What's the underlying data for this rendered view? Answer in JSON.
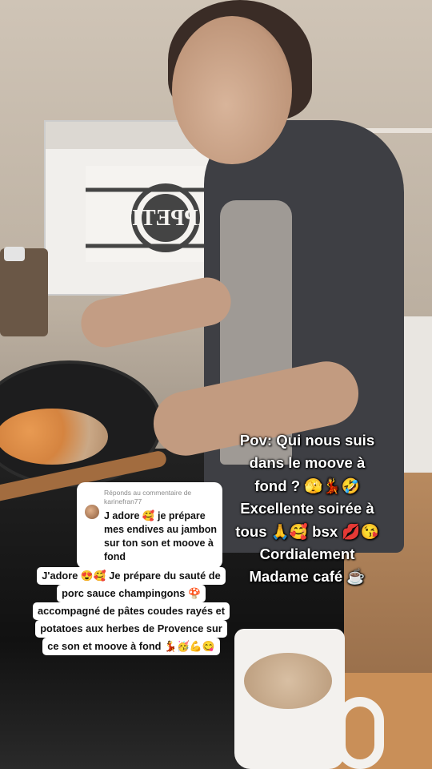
{
  "reply_sticker": {
    "header_line1": "Réponds au commentaire de",
    "header_line2": "karinefran77",
    "comment": "J adore 🥰 je prépare mes endives au jambon sur ton son et moove à fond"
  },
  "caption_lines": [
    "J'adore 😍🥰 Je prépare du sauté de",
    "porc sauce champingons 🍄",
    "accompagné de pâtes coudes rayés et",
    "potatoes aux herbes de Provence sur",
    "ce son et moove à fond 💃🥳💪😋"
  ],
  "overlay_lines": [
    "Pov: Qui nous suis",
    "dans le moove à",
    "fond ? 🫣💃🤣",
    "Excellente soirée à",
    "tous 🙏🥰 bsx 💋😘",
    "Cordialement",
    "Madame café ☕"
  ],
  "sticker_text": "APPETIT"
}
